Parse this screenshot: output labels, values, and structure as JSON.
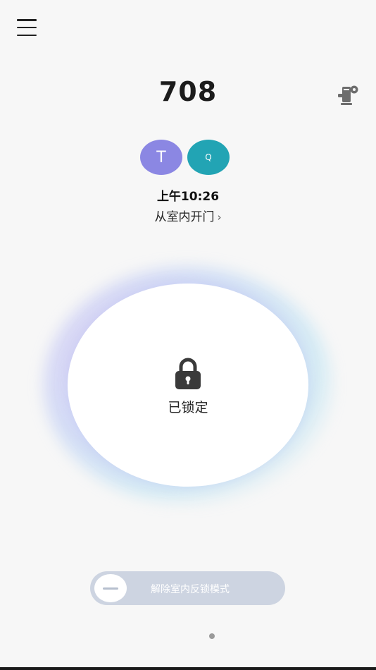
{
  "header": {
    "room_number": "708",
    "menu_icon": "hamburger-menu-icon",
    "settings_icon": "lock-settings-icon"
  },
  "members": [
    {
      "initial": "T",
      "color": "#8b87e3"
    },
    {
      "initial": "Q",
      "color": "#22a4b4"
    }
  ],
  "last_event": {
    "time": "上午10:26",
    "description": "从室内开门",
    "chevron": "›"
  },
  "lock": {
    "status": "已锁定",
    "icon": "padlock-icon"
  },
  "mode_toggle": {
    "label": "解除室内反锁模式"
  },
  "colors": {
    "accent_purple": "#8b87e3",
    "accent_teal": "#22a4b4",
    "toggle_bg": "#cdd4e1"
  }
}
